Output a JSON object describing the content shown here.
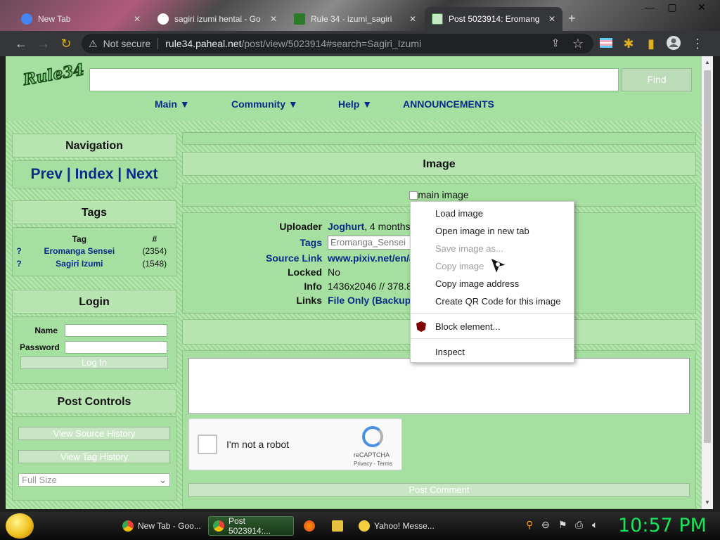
{
  "browser": {
    "tabs": [
      {
        "label": "New Tab",
        "active": false
      },
      {
        "label": "sagiri izumi hentai - Go",
        "active": false
      },
      {
        "label": "Rule 34 - izumi_sagiri",
        "active": false
      },
      {
        "label": "Post 5023914: Eromang",
        "active": true
      }
    ],
    "newtab_symbol": "+",
    "window_controls": {
      "min": "—",
      "max": "▢",
      "close": "✕"
    },
    "security_label": "Not secure",
    "url_host": "rule34.paheal.net",
    "url_path": "/post/view/5023914#search=Sagiri_Izumi",
    "icons": [
      "back-icon",
      "forward-icon",
      "reload-icon",
      "share-icon",
      "star-icon",
      "flag-extension-icon",
      "puzzle-icon",
      "sidepanel-icon",
      "profile-icon",
      "menu-icon"
    ]
  },
  "site": {
    "logo": "Rule34",
    "search_placeholder": "",
    "find_label": "Find",
    "nav": [
      {
        "label": "Main ▼"
      },
      {
        "label": "Community ▼"
      },
      {
        "label": "Help ▼"
      },
      {
        "label": "ANNOUNCEMENTS"
      }
    ]
  },
  "sidebar": {
    "navigation": {
      "title": "Navigation",
      "prev": "Prev",
      "index": "Index",
      "next": "Next",
      "sep": "|"
    },
    "tags": {
      "title": "Tags",
      "col_tag": "Tag",
      "col_count": "#",
      "rows": [
        {
          "q": "?",
          "name": "Eromanga Sensei",
          "count": "(2354)"
        },
        {
          "q": "?",
          "name": "Sagiri Izumi",
          "count": "(1548)"
        }
      ]
    },
    "login": {
      "title": "Login",
      "name_label": "Name",
      "password_label": "Password",
      "button": "Log In"
    },
    "post_controls": {
      "title": "Post Controls",
      "view_source_history": "View Source History",
      "view_tag_history": "View Tag History",
      "size_select": "Full Size"
    }
  },
  "main": {
    "image_title": "Image",
    "image_alt": "main image",
    "info": {
      "uploader_label": "Uploader",
      "uploader_name": "Joghurt",
      "uploader_time": ", 4 months",
      "tags_label": "Tags",
      "tags_value": "Eromanga_Sensei",
      "source_label": "Source Link",
      "source_value": "www.pixiv.net/en/a",
      "locked_label": "Locked",
      "locked_value": "No",
      "info_label": "Info",
      "info_value": "1436x2046 // 378.8",
      "links_label": "Links",
      "links_file_only": "File Only",
      "links_backup": "(Backup"
    },
    "comment": {
      "captcha_label": "I'm not a robot",
      "captcha_brand": "reCAPTCHA",
      "captcha_links": "Privacy - Terms",
      "post_button": "Post Comment"
    }
  },
  "context_menu": {
    "items": [
      {
        "label": "Load image",
        "enabled": true
      },
      {
        "label": "Open image in new tab",
        "enabled": true
      },
      {
        "label": "Save image as...",
        "enabled": false
      },
      {
        "label": "Copy image",
        "enabled": false
      },
      {
        "label": "Copy image address",
        "enabled": true
      },
      {
        "label": "Create QR Code for this image",
        "enabled": true
      },
      {
        "label": "Block element...",
        "enabled": true
      },
      {
        "label": "Inspect",
        "enabled": true
      }
    ]
  },
  "taskbar": {
    "items": [
      {
        "label": "New Tab - Goo...",
        "active": false
      },
      {
        "label": "Post 5023914:...",
        "active": true
      },
      {
        "label": "Yahoo! Messe...",
        "active": false
      }
    ],
    "clock": "10:57 PM"
  },
  "colors": {
    "page_bg": "#a6e0a0",
    "link": "#0b2a8a",
    "clock": "#19e35a",
    "tab_active": "#35363a"
  }
}
